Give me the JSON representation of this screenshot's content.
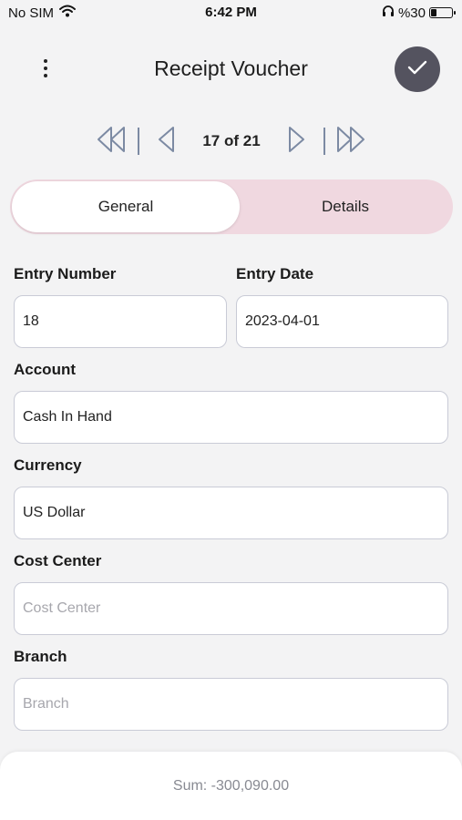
{
  "status_bar": {
    "carrier": "No SIM",
    "time": "6:42 PM",
    "battery_text": "%30",
    "battery_level": 0.3
  },
  "header": {
    "title": "Receipt Voucher"
  },
  "pager": {
    "count": "17 of 21"
  },
  "tabs": {
    "general": "General",
    "details": "Details",
    "active": "General"
  },
  "form": {
    "entry_number": {
      "label": "Entry Number",
      "value": "18"
    },
    "entry_date": {
      "label": "Entry Date",
      "value": "2023-04-01"
    },
    "account": {
      "label": "Account",
      "value": "Cash In Hand"
    },
    "currency": {
      "label": "Currency",
      "value": "US Dollar"
    },
    "cost_center": {
      "label": "Cost Center",
      "value": "",
      "placeholder": "Cost Center"
    },
    "branch": {
      "label": "Branch",
      "value": "",
      "placeholder": "Branch"
    }
  },
  "footer": {
    "sum": "Sum: -300,090.00"
  },
  "colors": {
    "accent_dark": "#54535f",
    "tab_bg": "#f0d8e0",
    "pager_icon": "#7c8aa3"
  }
}
